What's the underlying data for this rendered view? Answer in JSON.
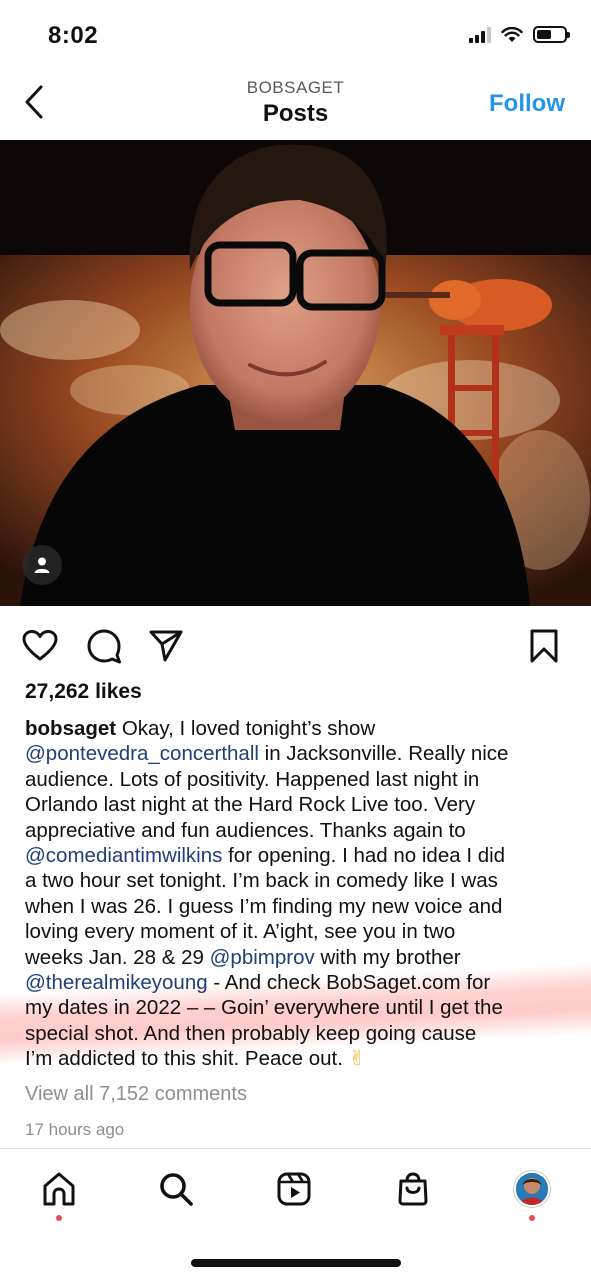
{
  "status_bar": {
    "time": "8:02",
    "battery_level": 0.55
  },
  "header": {
    "username": "BOBSAGET",
    "title": "Posts",
    "follow_label": "Follow"
  },
  "post": {
    "likes": "27,262 likes",
    "caption_lines": [
      [
        {
          "t": "bobsaget",
          "k": "user"
        },
        {
          "t": " Okay, I loved tonight’s show",
          "k": "text"
        }
      ],
      [
        {
          "t": "@pontevedra_concerthall",
          "k": "mention"
        },
        {
          "t": " in Jacksonville. Really nice",
          "k": "text"
        }
      ],
      [
        {
          "t": "audience. Lots of positivity. Happened last night in",
          "k": "text"
        }
      ],
      [
        {
          "t": "Orlando last night at the Hard Rock Live too. Very",
          "k": "text"
        }
      ],
      [
        {
          "t": "appreciative and fun audiences. Thanks again to",
          "k": "text"
        }
      ],
      [
        {
          "t": "@comediantimwilkins",
          "k": "mention"
        },
        {
          "t": " for opening. I had no idea I did",
          "k": "text"
        }
      ],
      [
        {
          "t": "a two hour set tonight. I’m back in comedy like I was",
          "k": "text"
        }
      ],
      [
        {
          "t": "when I was 26. I guess I’m finding my new voice and",
          "k": "text"
        }
      ],
      [
        {
          "t": "loving every moment of it. A’ight, see you in two",
          "k": "text"
        }
      ],
      [
        {
          "t": "weeks Jan. 28 & 29 ",
          "k": "text"
        },
        {
          "t": "@pbimprov",
          "k": "mention"
        },
        {
          "t": " with my brother",
          "k": "text"
        }
      ],
      [
        {
          "t": "@therealmikeyoung",
          "k": "mention"
        },
        {
          "t": " - And check BobSaget.com for",
          "k": "text"
        }
      ],
      [
        {
          "t": "my dates in 2022 – – Goin’ everywhere until I get the",
          "k": "text"
        }
      ],
      [
        {
          "t": "special shot. And then probably keep going cause",
          "k": "text"
        }
      ],
      [
        {
          "t": "I’m addicted to this shit. Peace out. ",
          "k": "text"
        },
        {
          "t": "✌",
          "k": "emoji"
        }
      ]
    ],
    "view_comments": "View all 7,152 comments",
    "timestamp": "17 hours ago"
  },
  "icons": {
    "back": "chevron-left-icon",
    "like": "heart-icon",
    "comment": "comment-icon",
    "share": "send-icon",
    "save": "bookmark-icon",
    "tag": "person-tag-icon",
    "nav": [
      "home-icon",
      "search-icon",
      "reels-icon",
      "shop-icon",
      "profile-avatar"
    ]
  },
  "colors": {
    "accent": "#2196e8",
    "mention": "#1f3f7a",
    "muted": "#8e8e8e",
    "notification": "#ed4956"
  }
}
